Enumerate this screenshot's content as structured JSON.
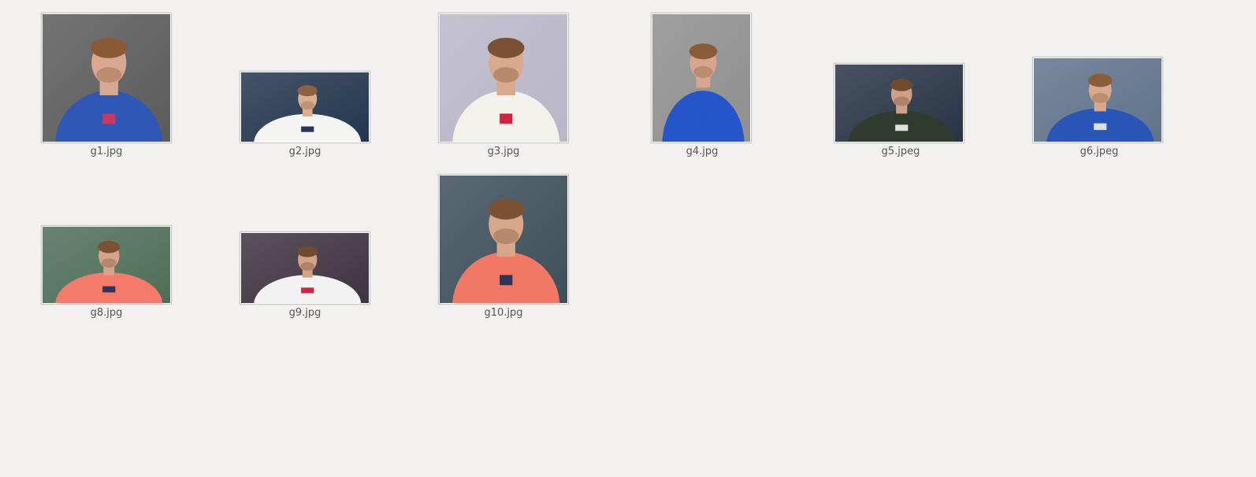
{
  "files": [
    {
      "id": "g1",
      "name": "g1.jpg",
      "icon": "photo-thumbnail-icon",
      "bg": "#5b5b5b",
      "shirt": "#2f58b6",
      "accent": "#d9355a",
      "skin": "#d9a890",
      "hair": "#8a5a36"
    },
    {
      "id": "g2",
      "name": "g2.jpg",
      "icon": "photo-thumbnail-icon",
      "bg": "#23364e",
      "shirt": "#f4f4f2",
      "accent": "#13204a",
      "skin": "#dcae90",
      "hair": "#8d6240"
    },
    {
      "id": "g3",
      "name": "g3.jpg",
      "icon": "photo-thumbnail-icon",
      "bg": "#b9b6c8",
      "shirt": "#f2f1ec",
      "accent": "#c8102e",
      "skin": "#d9a88d",
      "hair": "#7a5233"
    },
    {
      "id": "g4",
      "name": "g4.jpg",
      "icon": "photo-thumbnail-icon",
      "bg": "#8f8f8f",
      "shirt": "#2555c8",
      "accent": "#2555c8",
      "skin": "#d8a68e",
      "hair": "#8a5b37"
    },
    {
      "id": "g5",
      "name": "g5.jpeg",
      "icon": "photo-thumbnail-icon",
      "bg": "#283446",
      "shirt": "#2f3b2c",
      "accent": "#f3f3f3",
      "skin": "#cfa087",
      "hair": "#6f4a2e"
    },
    {
      "id": "g6",
      "name": "g6.jpeg",
      "icon": "photo-thumbnail-icon",
      "bg": "#60738b",
      "shirt": "#2a55b8",
      "accent": "#f0f0f0",
      "skin": "#d8a88e",
      "hair": "#8a5d38"
    },
    {
      "id": "g8",
      "name": "g8.jpg",
      "icon": "photo-thumbnail-icon",
      "bg": "#4e6e58",
      "shirt": "#f47a6a",
      "accent": "#1d2b55",
      "skin": "#d6a48a",
      "hair": "#7a5233"
    },
    {
      "id": "g9",
      "name": "g9.jpg",
      "icon": "photo-thumbnail-icon",
      "bg": "#3e3340",
      "shirt": "#f2f2f2",
      "accent": "#c8102e",
      "skin": "#d3a287",
      "hair": "#6f4a2e"
    },
    {
      "id": "g10",
      "name": "g10.jpg",
      "icon": "photo-thumbnail-icon",
      "bg": "#3d4f5a",
      "shirt": "#f27866",
      "accent": "#1c2a57",
      "skin": "#d7a68b",
      "hair": "#7a5233"
    }
  ]
}
